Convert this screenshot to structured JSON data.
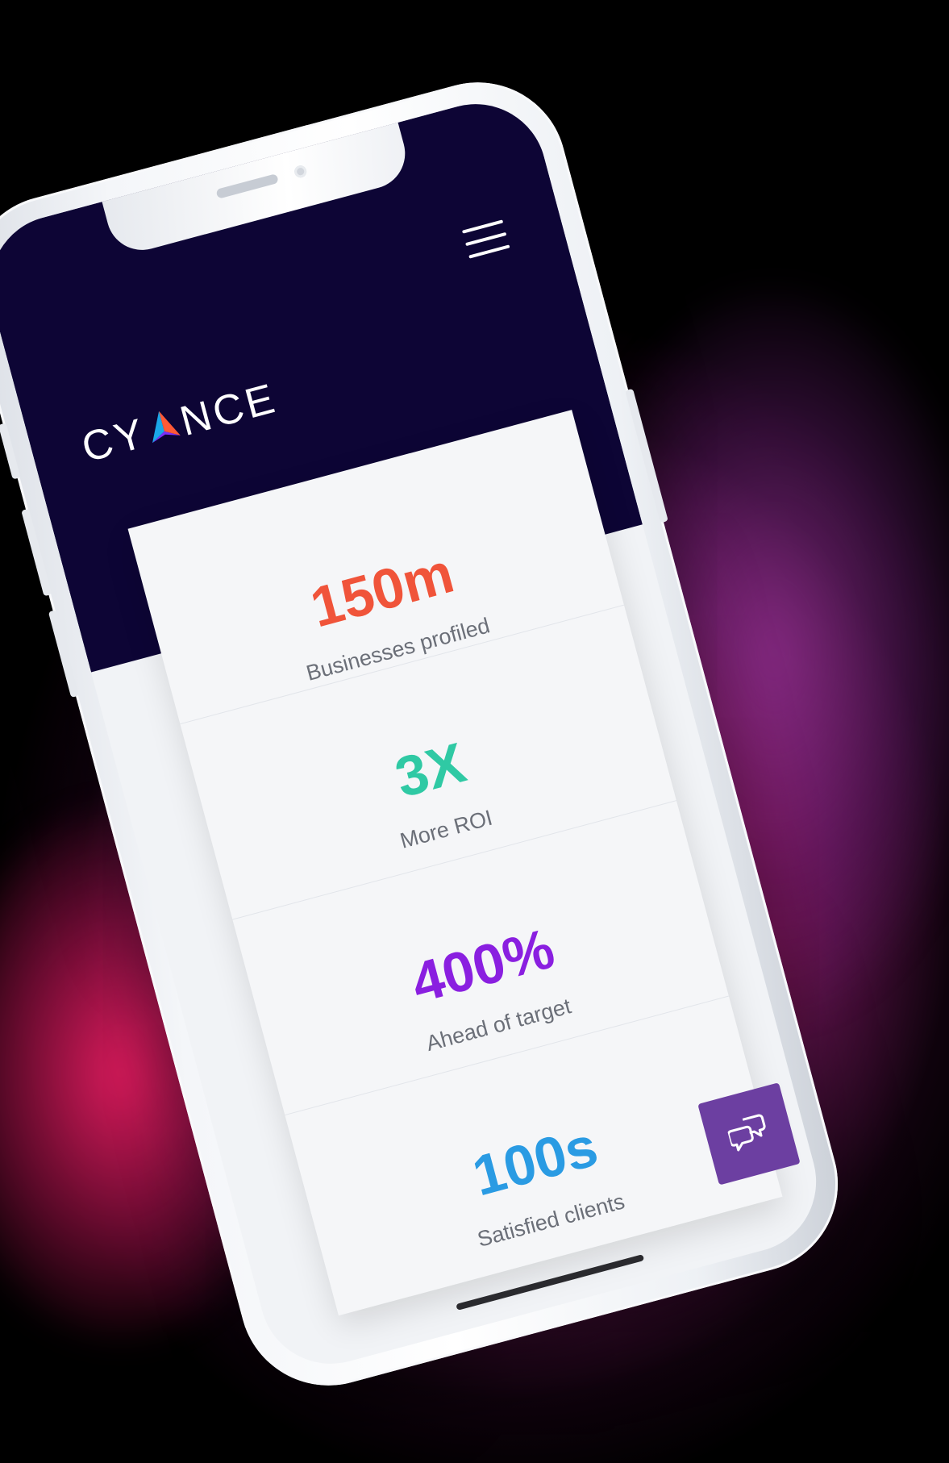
{
  "brand": {
    "logo_text_left": "CY",
    "logo_text_right": "NCE",
    "logo_full": "CYANCE"
  },
  "icons": {
    "menu": "hamburger-menu-icon",
    "chat": "chat-bubbles-icon",
    "logo_mark": "triangle-a-icon"
  },
  "stats": [
    {
      "value": "150m",
      "label": "Businesses profiled",
      "color": "#f0543a"
    },
    {
      "value": "3X",
      "label": "More ROI",
      "color": "#2fc9a4"
    },
    {
      "value": "400%",
      "label": "Ahead of target",
      "color": "#8a1fe0"
    },
    {
      "value": "100s",
      "label": "Satisfied clients",
      "color": "#2a9be3"
    }
  ],
  "colors": {
    "header_bg": "#0d0535",
    "chat_button_bg": "#6c3fa1",
    "background_glow": "#e91e78"
  }
}
